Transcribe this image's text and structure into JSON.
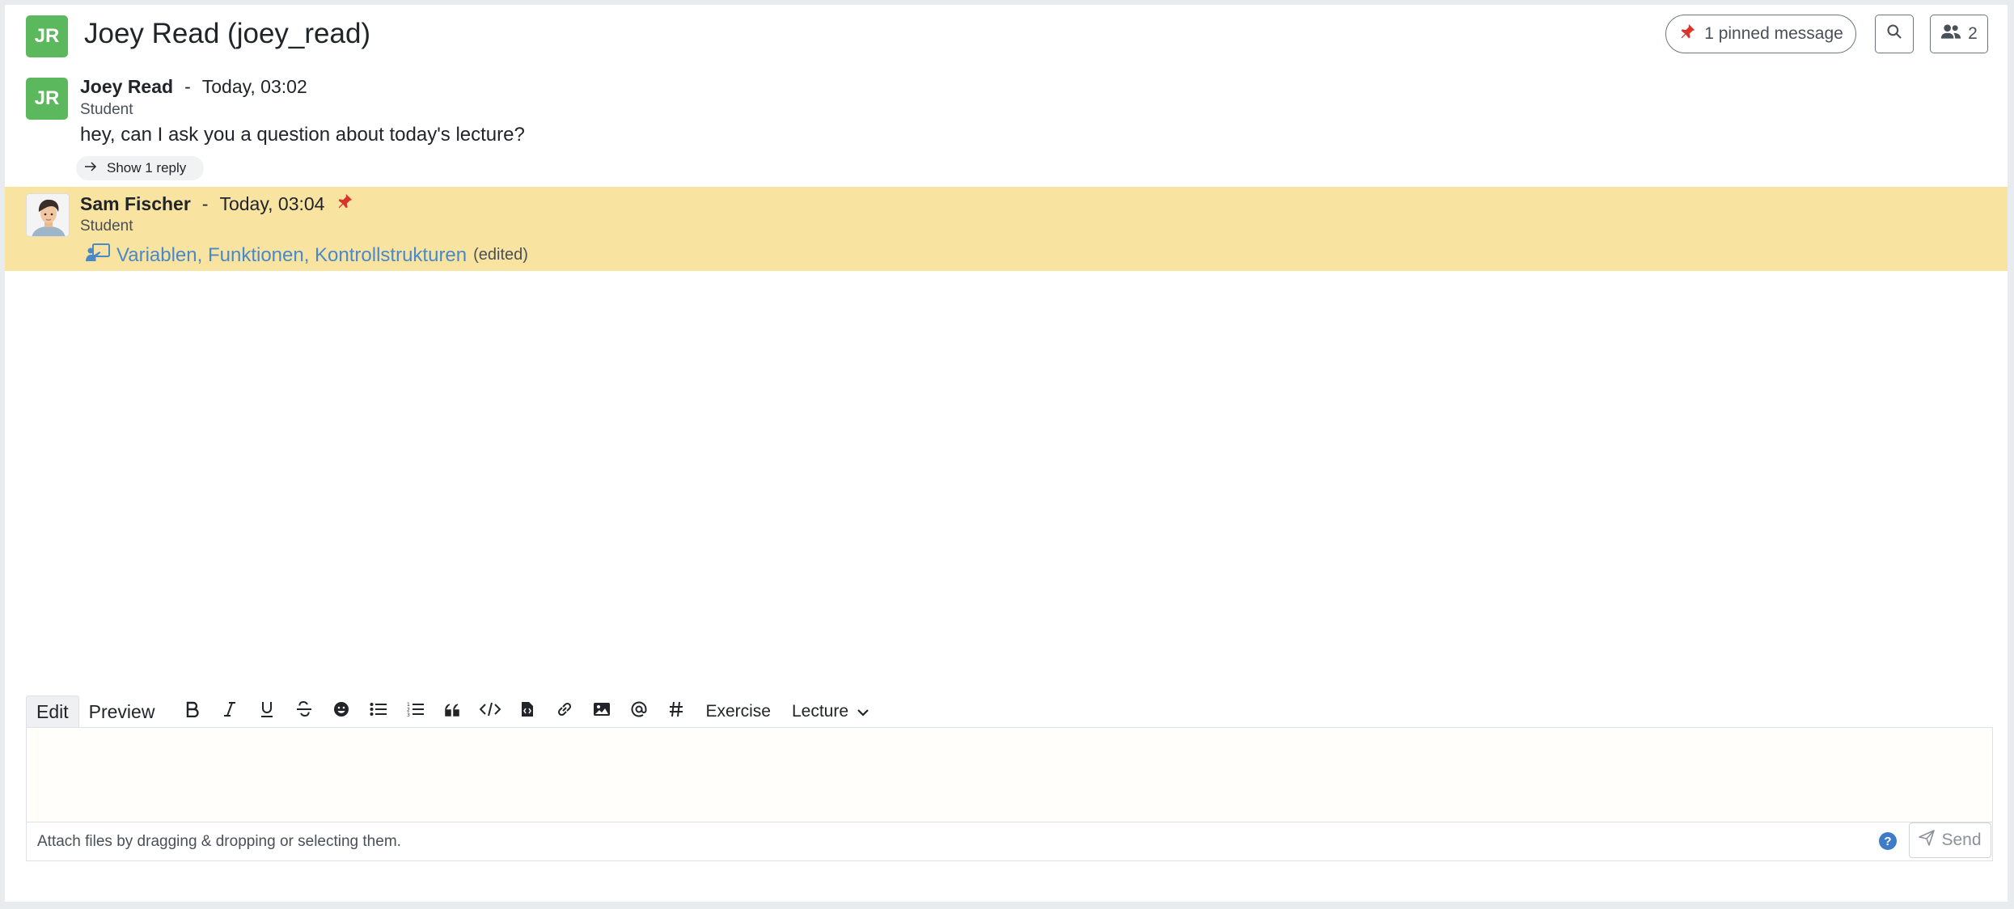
{
  "header": {
    "avatar_initials": "JR",
    "title": "Joey Read (joey_read)",
    "pinned_label": "1 pinned message",
    "members_count": "2"
  },
  "messages": [
    {
      "avatar_initials": "JR",
      "author": "Joey Read",
      "separator": "-",
      "time": "Today, 03:02",
      "role": "Student",
      "content": "hey, can I ask you a question about today's lecture?",
      "reply_label": "Show 1 reply"
    },
    {
      "author": "Sam Fischer",
      "separator": "-",
      "time": "Today, 03:04",
      "role": "Student",
      "lecture_link": "Variablen, Funktionen, Kontrollstrukturen",
      "edited_label": "(edited)",
      "pinned": true
    }
  ],
  "editor": {
    "tabs": [
      "Edit",
      "Preview"
    ],
    "exercise_label": "Exercise",
    "lecture_label": "Lecture",
    "attach_hint": "Attach files by dragging & dropping or selecting them.",
    "help_label": "?",
    "send_label": "Send"
  },
  "colors": {
    "avatar_green": "#5cb85c",
    "highlight": "#f9e3a1",
    "link": "#4a89c9"
  }
}
